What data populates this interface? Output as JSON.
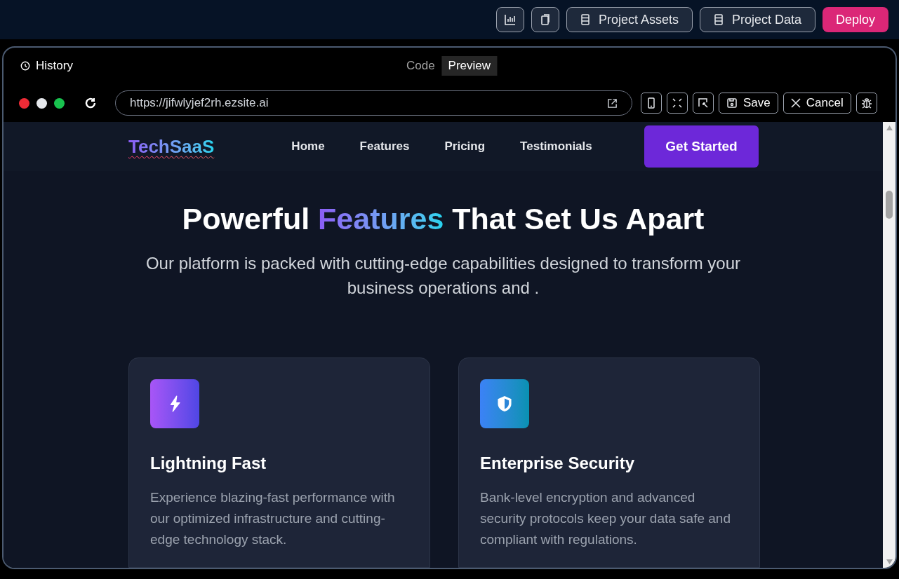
{
  "top_bar": {
    "icon_buttons": [
      {
        "kind": "chart"
      },
      {
        "kind": "copy"
      }
    ],
    "buttons": [
      {
        "label": "Project Assets",
        "kind": "outline"
      },
      {
        "label": "Project Data",
        "kind": "outline"
      },
      {
        "label": "Deploy",
        "kind": "primary"
      }
    ]
  },
  "panel": {
    "history_label": "History",
    "mode_tabs": [
      {
        "label": "Code",
        "selected": false
      },
      {
        "label": "Preview",
        "selected": true
      }
    ],
    "url": "https://jifwlyjef2rh.ezsite.ai",
    "tools": [
      {
        "kind": "mobile"
      },
      {
        "kind": "fullscreen"
      },
      {
        "kind": "select"
      }
    ],
    "save_label": "Save",
    "cancel_label": "Cancel"
  },
  "site": {
    "logo": "TechSaaS",
    "nav": [
      "Home",
      "Features",
      "Pricing",
      "Testimonials"
    ],
    "cta": "Get Started",
    "headline": [
      {
        "text": "Powerful ",
        "kind": "plain"
      },
      {
        "text": "Features",
        "kind": "gradient"
      },
      {
        "text": " That Set Us Apart",
        "kind": "plain"
      }
    ],
    "subtitle": "Our platform is packed with cutting-edge capabilities designed to transform your business operations and .",
    "features": [
      {
        "kind": "bolt",
        "title": "Lightning Fast",
        "text": "Experience blazing-fast performance with our optimized infrastructure and cutting-edge technology stack."
      },
      {
        "kind": "shield",
        "title": "Enterprise Security",
        "text": "Bank-level encryption and advanced security protocols keep your data safe and compliant with regulations."
      }
    ]
  }
}
